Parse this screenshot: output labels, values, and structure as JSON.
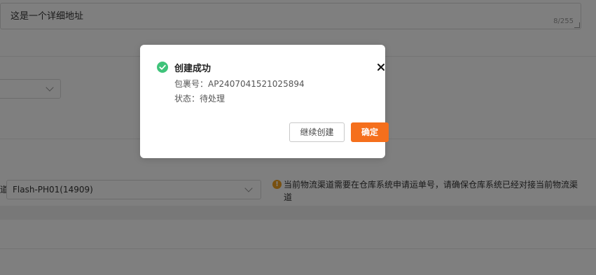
{
  "form": {
    "address_value": "这是一个详细地址",
    "address_count": "8/255",
    "row_label": "道",
    "channel_value": "Flash-PH01(14909)",
    "notice": "当前物流渠道需要在仓库系统申请运单号，请确保仓库系统已经对接当前物流渠道"
  },
  "dialog": {
    "title": "创建成功",
    "package_line": "包裹号：AP2407041521025894",
    "status_line": "状态：待处理",
    "continue_label": "继续创建",
    "confirm_label": "确定"
  },
  "colors": {
    "primary": "#f56f1c",
    "success": "#3fc37a",
    "warning": "#f0a020"
  },
  "icons": {
    "success": "check-circle-icon",
    "close": "close-icon",
    "info": "info-icon",
    "dropdown": "chevron-down-icon"
  }
}
